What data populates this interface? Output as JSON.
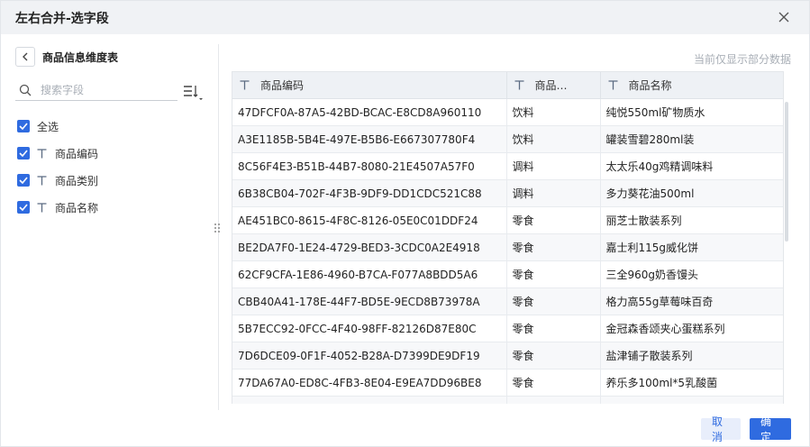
{
  "dialog": {
    "title": "左右合并-选字段",
    "cancel_label": "取消",
    "ok_label": "确定",
    "hint": "当前仅显示部分数据"
  },
  "left": {
    "table_name": "商品信息维度表",
    "search_placeholder": "搜索字段",
    "select_all_label": "全选",
    "fields": [
      {
        "label": "商品编码",
        "checked": true
      },
      {
        "label": "商品类别",
        "checked": true
      },
      {
        "label": "商品名称",
        "checked": true
      }
    ]
  },
  "grid": {
    "columns": [
      "商品编码",
      "商品…",
      "商品名称"
    ],
    "rows": [
      [
        "47DFCF0A-87A5-42BD-BCAC-E8CD8A960110",
        "饮料",
        "纯悦550ml矿物质水"
      ],
      [
        "A3E1185B-5B4E-497E-B5B6-E667307780F4",
        "饮料",
        "罐装雪碧280ml装"
      ],
      [
        "8C56F4E3-B51B-44B7-8080-21E4507A57F0",
        "调料",
        "太太乐40g鸡精调味料"
      ],
      [
        "6B38CB04-702F-4F3B-9DF9-DD1CDC521C88",
        "调料",
        "多力葵花油500ml"
      ],
      [
        "AE451BC0-8615-4F8C-8126-05E0C01DDF24",
        "零食",
        "丽芝士散装系列"
      ],
      [
        "BE2DA7F0-1E24-4729-BED3-3CDC0A2E4918",
        "零食",
        "嘉士利115g威化饼"
      ],
      [
        "62CF9CFA-1E86-4960-B7CA-F077A8BDD5A6",
        "零食",
        "三全960g奶香馒头"
      ],
      [
        "CBB40A41-178E-44F7-BD5E-9ECD8B73978A",
        "零食",
        "格力高55g草莓味百奇"
      ],
      [
        "5B7ECC92-0FCC-4F40-98FF-82126D87E80C",
        "零食",
        "金冠森香颂夹心蛋糕系列"
      ],
      [
        "7D6DCE09-0F1F-4052-B28A-D7399DE9DF19",
        "零食",
        "盐津铺子散装系列"
      ],
      [
        "77DA67A0-ED8C-4FB3-8E04-E9EA7DD96BE8",
        "零食",
        "养乐多100ml*5乳酸菌"
      ],
      [
        "",
        "",
        ""
      ]
    ]
  }
}
